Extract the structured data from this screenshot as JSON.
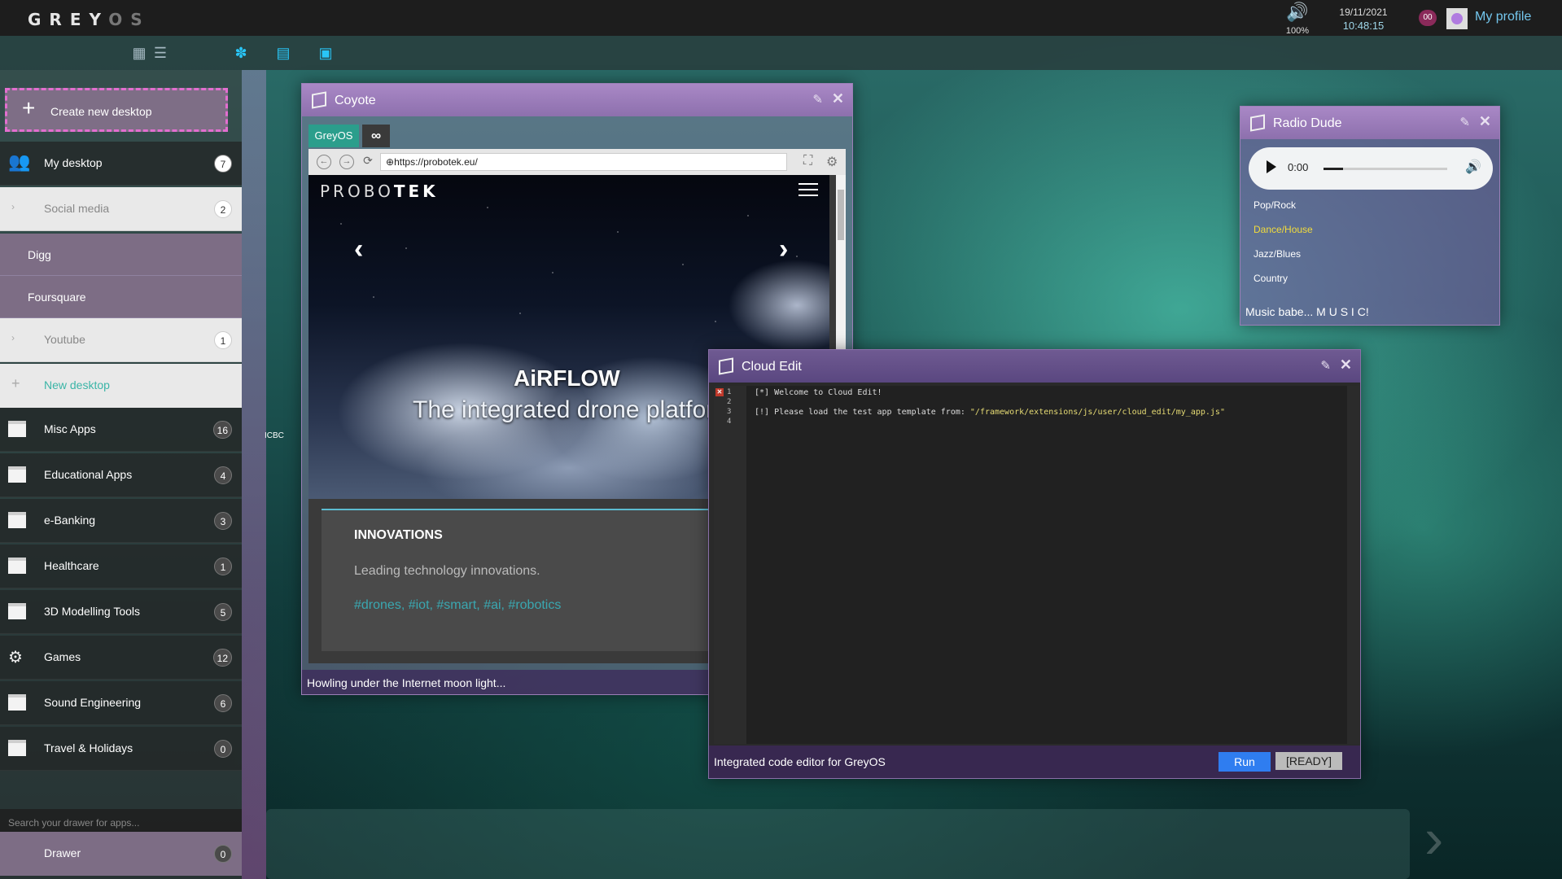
{
  "topbar": {
    "logo_main": "GREY",
    "logo_dim": "OS",
    "volume_pct": "100%",
    "volume_icon": "speaker-icon",
    "date": "19/11/2021",
    "time": "10:48:15",
    "notifications": "00",
    "profile_label": "My profile"
  },
  "toolbar": {
    "icons": [
      "grid-icon",
      "stack-icon",
      "paw-icon",
      "window-icon",
      "browser-icon"
    ]
  },
  "sidebar": {
    "create_label": "Create new desktop",
    "items": [
      {
        "label": "My desktop",
        "count": "7"
      },
      {
        "label": "Social media",
        "count": "2"
      },
      {
        "label": "Digg"
      },
      {
        "label": "Foursquare"
      },
      {
        "label": "Youtube",
        "count": "1"
      },
      {
        "label": "New desktop"
      },
      {
        "label": "Misc Apps",
        "count": "16"
      },
      {
        "label": "Educational Apps",
        "count": "4"
      },
      {
        "label": "e-Banking",
        "count": "3"
      },
      {
        "label": "Healthcare",
        "count": "1"
      },
      {
        "label": "3D Modelling Tools",
        "count": "5"
      },
      {
        "label": "Games",
        "count": "12"
      },
      {
        "label": "Sound Engineering",
        "count": "6"
      },
      {
        "label": "Travel & Holidays",
        "count": "0"
      }
    ],
    "search_placeholder": "Search your drawer for apps...",
    "drawer_label": "Drawer",
    "drawer_count": "0"
  },
  "coyote": {
    "title": "Coyote",
    "tab_label": "GreyOS",
    "url": "https://probotek.eu/",
    "site_logo_a": "PROBO",
    "site_logo_b": "TEK",
    "hero_title": "AiRFLOW",
    "hero_sub": "The integrated drone platfor",
    "section_head": "INNOVATIONS",
    "section_text": "Leading technology innovations.",
    "section_tags": "#drones, #iot, #smart, #ai, #robotics",
    "footer": "Howling under the Internet moon light..."
  },
  "radio": {
    "title": "Radio Dude",
    "time": "0:00",
    "genres": [
      "Pop/Rock",
      "Dance/House",
      "Jazz/Blues",
      "Country"
    ],
    "footer": "Music babe... M U S I C!"
  },
  "cloud_edit": {
    "title": "Cloud Edit",
    "lines": [
      "1",
      "2",
      "3",
      "4"
    ],
    "line1": "[*] Welcome to Cloud Edit!",
    "line3_prefix": "[!] Please load the test app template from: ",
    "line3_path": "\"/framework/extensions/js/user/cloud_edit/my_app.js\"",
    "footer": "Integrated code editor for GreyOS",
    "run_label": "Run",
    "status": "[READY]"
  },
  "desktop_tag": "ICBC"
}
